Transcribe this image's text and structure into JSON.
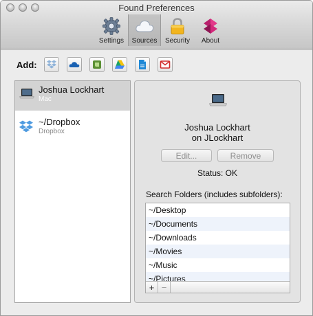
{
  "window": {
    "title": "Found Preferences"
  },
  "toolbar": {
    "tabs": [
      {
        "label": "Settings",
        "icon": "gear-icon"
      },
      {
        "label": "Sources",
        "icon": "cloud-icon",
        "active": true
      },
      {
        "label": "Security",
        "icon": "lock-icon"
      },
      {
        "label": "About",
        "icon": "found-logo-icon"
      }
    ]
  },
  "add": {
    "label": "Add:",
    "services": [
      "dropbox-icon",
      "onedrive-icon",
      "evernote-icon",
      "google-drive-icon",
      "box-icon",
      "gmail-icon"
    ]
  },
  "sources": [
    {
      "name": "Joshua Lockhart",
      "type": "Mac",
      "icon": "laptop-icon",
      "selected": true
    },
    {
      "name": "~/Dropbox",
      "type": "Dropbox",
      "icon": "dropbox-icon",
      "selected": false
    }
  ],
  "detail": {
    "owner_line1": "Joshua Lockhart",
    "owner_line2": "on JLockhart",
    "edit_label": "Edit...",
    "remove_label": "Remove",
    "status": "Status: OK",
    "folders_label": "Search Folders (includes subfolders):",
    "folders": [
      "~/Desktop",
      "~/Documents",
      "~/Downloads",
      "~/Movies",
      "~/Music",
      "~/Pictures"
    ],
    "add_folder": "+",
    "remove_folder": "−"
  },
  "colors": {
    "accent": "#d8dce6",
    "brand_pink": "#d4297c"
  }
}
